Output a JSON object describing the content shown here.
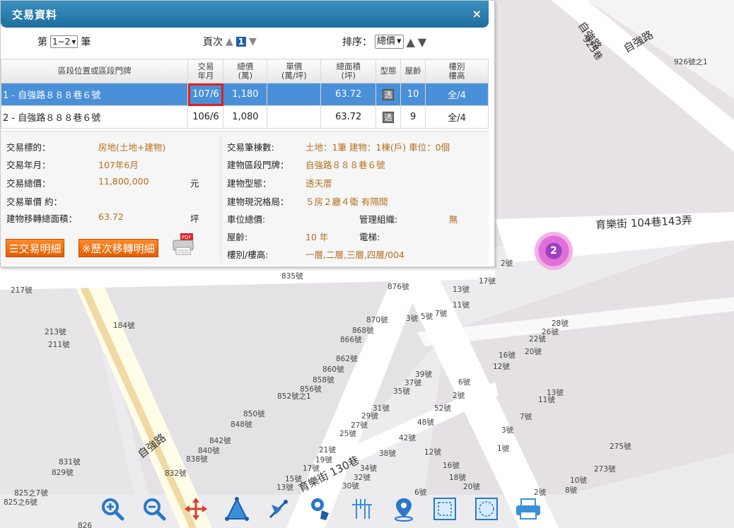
{
  "map": {
    "street_labels": [
      "自強路",
      "925巷",
      "自強路",
      "育樂街 104巷143弄",
      "自強路",
      "育樂街 130巷"
    ],
    "house_numbers": [
      "926號之1",
      "217號",
      "184號",
      "213號",
      "211號",
      "835號",
      "876號",
      "13號",
      "11號",
      "17號",
      "2號",
      "870號",
      "868號",
      "866號",
      "3號",
      "5號",
      "7號",
      "28號",
      "26號",
      "22號",
      "20號",
      "16號",
      "12號",
      "862號",
      "860號",
      "858號",
      "856號",
      "852號之1",
      "850號",
      "848號",
      "39號",
      "37號",
      "35號",
      "6號",
      "2號",
      "13號",
      "11號",
      "31號",
      "29號",
      "27號",
      "25號",
      "52號",
      "48號",
      "42號",
      "7號",
      "3號",
      "842號",
      "840號",
      "838號",
      "832號",
      "831號",
      "829號",
      "21號",
      "19號",
      "17號",
      "15號",
      "13號",
      "38號",
      "34號",
      "32號",
      "30號",
      "12號",
      "16號",
      "18號",
      "20號",
      "1號",
      "275號",
      "273號",
      "10號",
      "8號",
      "2號",
      "6號",
      "825之7號",
      "825之6號",
      "826"
    ],
    "cluster_count": "2"
  },
  "dialog": {
    "title": "交易資料",
    "close_icon": "×",
    "range_prefix": "第",
    "range_value": "1~2",
    "range_suffix": "筆",
    "page_label": "頁次",
    "page_value": "1",
    "sort_label": "排序：",
    "sort_value": "總價",
    "table": {
      "headers": {
        "location": "區段位置或區段門牌",
        "date_l1": "交易",
        "date_l2": "年月",
        "total_l1": "總價",
        "total_l2": "(萬)",
        "unit_l1": "單價",
        "unit_l2": "(萬/坪)",
        "area_l1": "總面積",
        "area_l2": "(坪)",
        "type": "型態",
        "age": "屋齡",
        "floor_l1": "樓別",
        "floor_l2": "樓高"
      },
      "rows": [
        {
          "location": "1 - 自強路８８８巷６號",
          "date": "107/6",
          "total": "1,180",
          "unit": "",
          "area": "63.72",
          "type": "透",
          "age": "10",
          "floor": "全/4"
        },
        {
          "location": "2 - 自強路８８８巷６號",
          "date": "106/6",
          "total": "1,080",
          "unit": "",
          "area": "63.72",
          "type": "透",
          "age": "9",
          "floor": "全/4"
        }
      ]
    },
    "details": {
      "target_label": "交易標的：",
      "target_value": "房地(土地+建物)",
      "date_label": "交易年月：",
      "date_value": "107年6月",
      "price_label": "交易總價：",
      "price_value": "11,800,000",
      "price_unit": "元",
      "unit_price_label": "交易單價 約：",
      "area_label": "建物移轉總面積：",
      "area_value": "63.72",
      "area_unit": "坪",
      "count_label": "交易筆棟數:",
      "count_value": "土地：1筆 建物：1棟(戶) 車位：0個",
      "address_label": "建物區段門牌：",
      "address_value": "自強路８８８巷６號",
      "building_type_label": "建物型態：",
      "building_type_value": "透天厝",
      "layout_label": "建物現況格局：",
      "layout_value": "５房２廳４衛 有隔間",
      "parking_label": "車位總價:",
      "management_label": "管理組織:",
      "management_value": "無",
      "age_label": "屋齡:",
      "age_value": "10 年",
      "elevator_label": "電梯:",
      "floor_label": "樓別/樓高:",
      "floor_value": "一層,二層,三層,四層/004"
    },
    "buttons": {
      "details": "交易明細",
      "history": "※歷次移轉明細"
    }
  }
}
